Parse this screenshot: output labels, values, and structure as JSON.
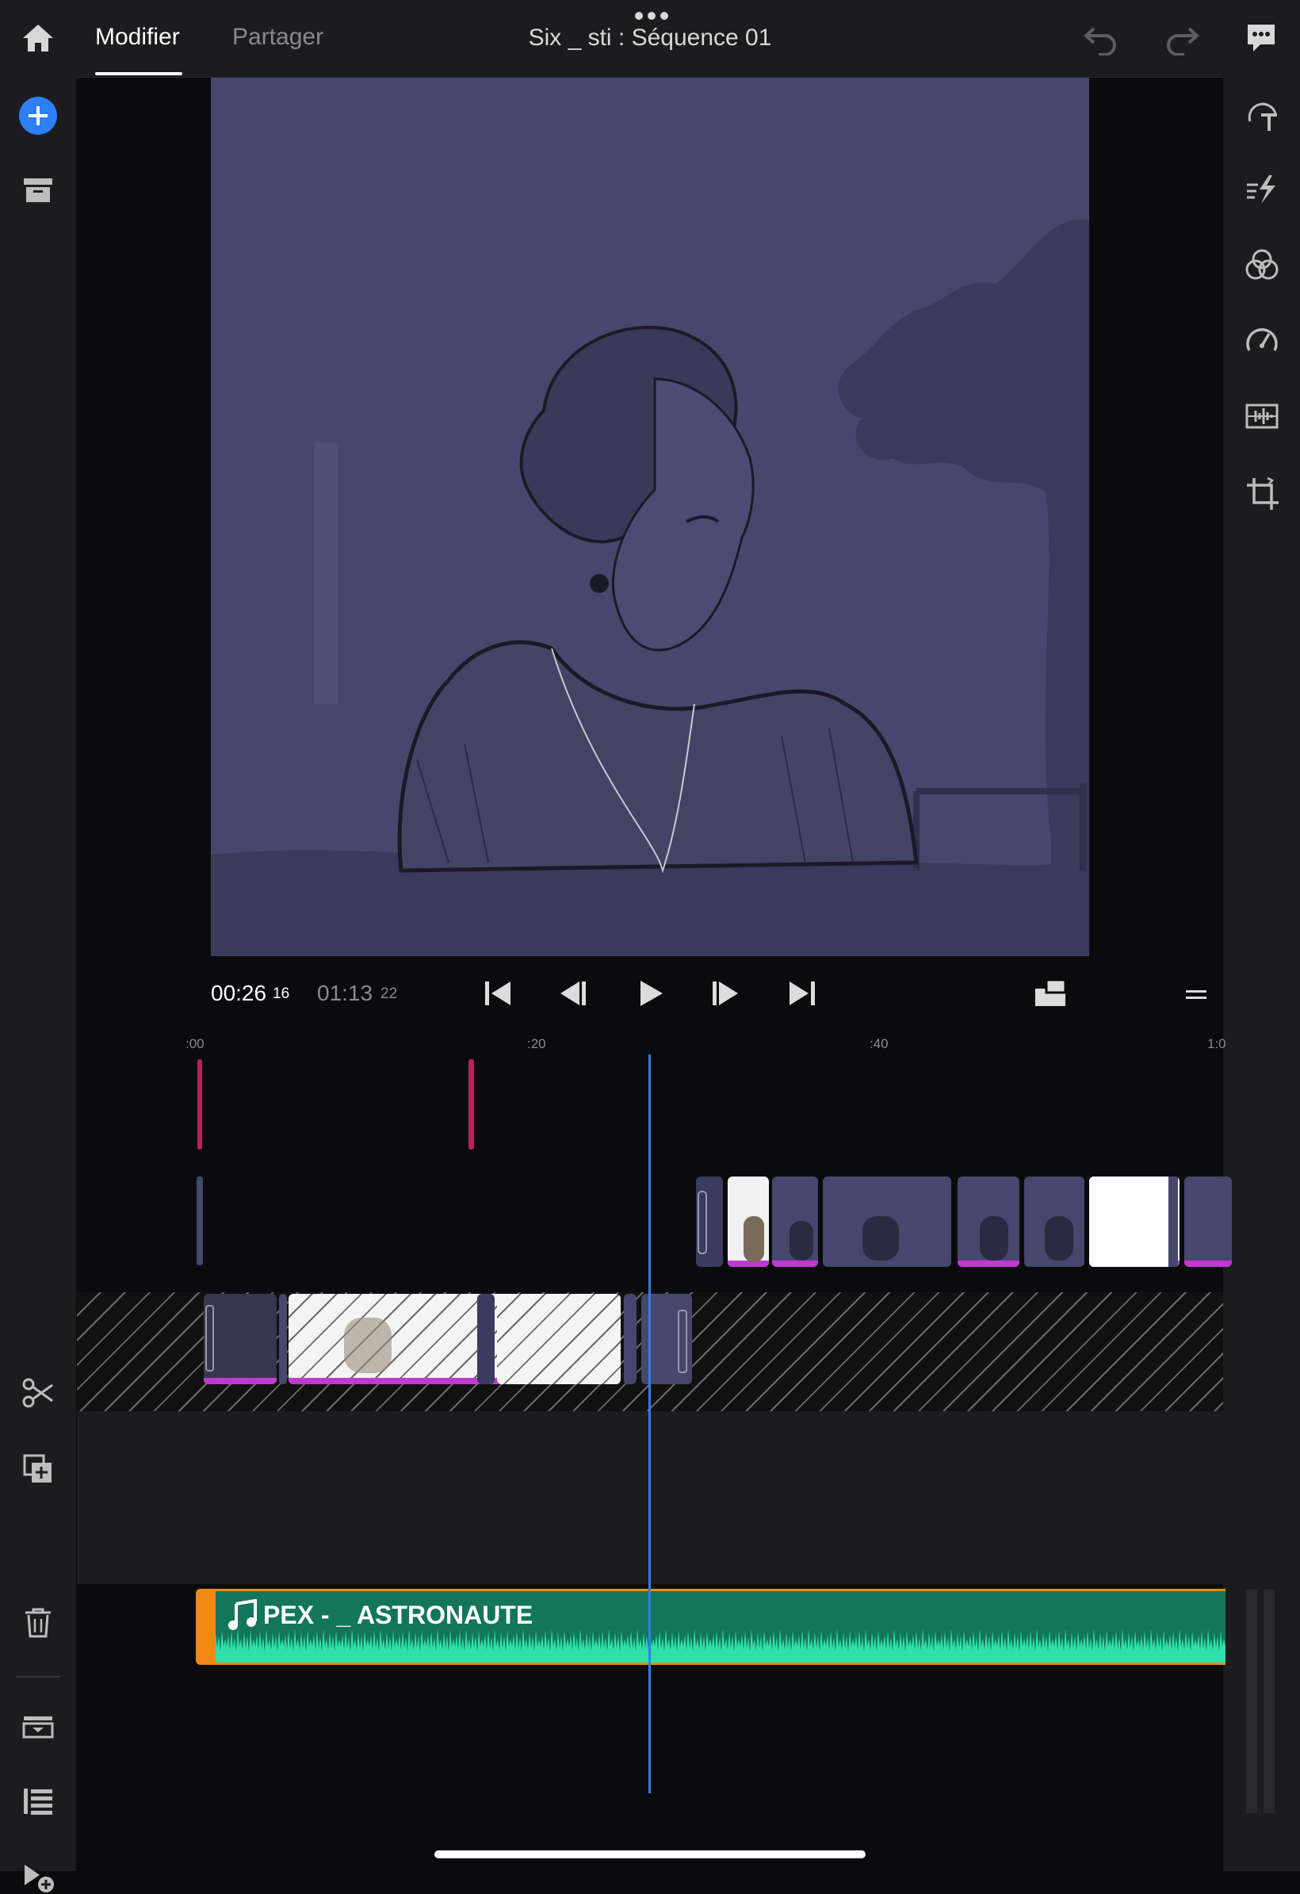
{
  "header": {
    "tabs": [
      {
        "label": "Modifier",
        "active": true
      },
      {
        "label": "Partager",
        "active": false
      }
    ],
    "title": "Six _ sti : Séquence  01",
    "icons": [
      "home-icon",
      "more-icon",
      "undo-icon",
      "redo-icon",
      "comment-icon"
    ]
  },
  "left_toolbar": {
    "top_icons": [
      "add-icon",
      "archive-icon"
    ],
    "bottom_icons": [
      "scissors-icon",
      "duplicate-icon",
      "trash-icon",
      "track-icon",
      "list-icon",
      "add-media-icon"
    ]
  },
  "right_toolbar": {
    "icons": [
      "text-icon",
      "effects-icon",
      "color-icon",
      "speed-icon",
      "audio-icon",
      "crop-icon"
    ]
  },
  "transport": {
    "current_time": "00:26",
    "current_frames": "16",
    "duration": "01:13",
    "duration_frames": "22"
  },
  "timeline": {
    "ruler_labels": [
      ":00",
      ":20",
      ":40",
      "1:0"
    ],
    "audio_clip_label": "PEX - _ ASTRONAUTE"
  },
  "colors": {
    "accent": "#2d7ff5",
    "audio_clip": "#13755c",
    "audio_border": "#f08a14",
    "clip_marker": "#c03ad0",
    "viewer_tint": "#45476d"
  }
}
